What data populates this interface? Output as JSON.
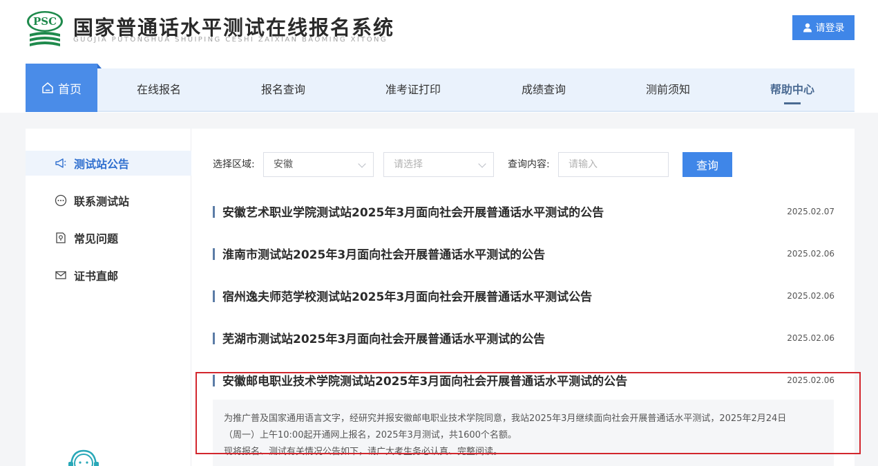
{
  "header": {
    "logo_text": "PSC",
    "title": "国家普通话水平测试在线报名系统",
    "subtitle": "GUOJIA PUTONGHUA SHUIPING CESHI ZAIXIAN BAOMING XITONG",
    "login_label": "请登录"
  },
  "nav": {
    "home": "首页",
    "items": [
      "在线报名",
      "报名查询",
      "准考证打印",
      "成绩查询",
      "测前须知",
      "帮助中心"
    ],
    "active": "帮助中心"
  },
  "sidebar": {
    "items": [
      {
        "label": "测试站公告",
        "icon": "megaphone-icon",
        "active": true
      },
      {
        "label": "联系测试站",
        "icon": "chat-icon",
        "active": false
      },
      {
        "label": "常见问题",
        "icon": "question-doc-icon",
        "active": false
      },
      {
        "label": "证书直邮",
        "icon": "mail-icon",
        "active": false
      }
    ]
  },
  "filters": {
    "region_label": "选择区域:",
    "region_value": "安徽",
    "city_placeholder": "请选择",
    "query_label": "查询内容:",
    "query_placeholder": "请输入",
    "search_button": "查询"
  },
  "news": [
    {
      "title": "安徽艺术职业学院测试站2025年3月面向社会开展普通话水平测试的公告",
      "date": "2025.02.07"
    },
    {
      "title": "淮南市测试站2025年3月面向社会开展普通话水平测试的公告",
      "date": "2025.02.06"
    },
    {
      "title": "宿州逸夫师范学校测试站2025年3月面向社会开展普通话水平测试公告",
      "date": "2025.02.06"
    },
    {
      "title": "芜湖市测试站2025年3月面向社会开展普通话水平测试的公告",
      "date": "2025.02.06"
    },
    {
      "title": "安徽邮电职业技术学院测试站2025年3月面向社会开展普通话水平测试的公告",
      "date": "2025.02.06"
    }
  ],
  "excerpt": {
    "line1": "为推广普及国家通用语言文字，经研究并报安徽邮电职业技术学院同意，我站2025年3月继续面向社会开展普通话水平测试，2025年2月24日",
    "line2": "（周一）上午10:00起开通网上报名，2025年3月测试，共1600个名额。",
    "line3": "现将报名、测试有关情况公告如下，请广大考生务必认真、完整阅读。"
  },
  "colors": {
    "accent": "#3f86e8",
    "nav_bg": "#eaf2fc",
    "highlight": "#d2262d"
  }
}
